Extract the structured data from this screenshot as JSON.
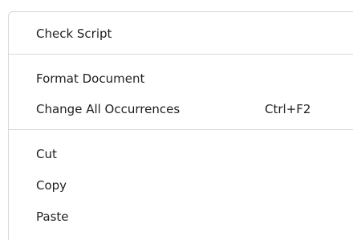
{
  "menu": {
    "items": [
      {
        "label": "Check Script"
      },
      {
        "label": "Format Document"
      },
      {
        "label": "Change All Occurrences",
        "shortcut": "Ctrl+F2"
      },
      {
        "label": "Cut"
      },
      {
        "label": "Copy"
      },
      {
        "label": "Paste"
      }
    ]
  }
}
